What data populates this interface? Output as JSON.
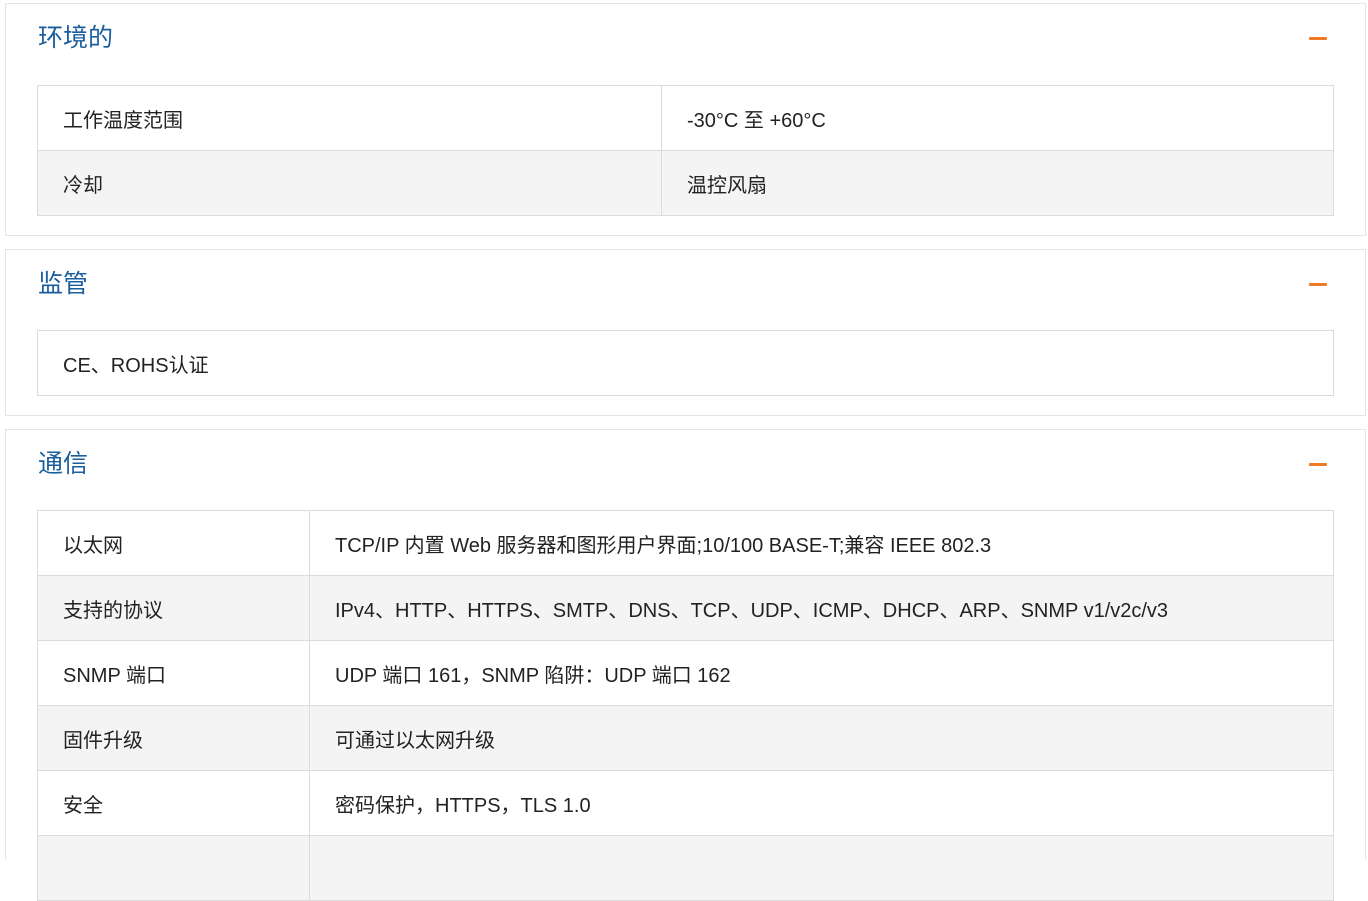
{
  "sections": {
    "environment": {
      "title": "环境的",
      "rows": [
        {
          "label": "工作温度范围",
          "value": "-30°C 至 +60°C"
        },
        {
          "label": "冷却",
          "value": "温控风扇"
        }
      ]
    },
    "regulatory": {
      "title": "监管",
      "text": "CE、ROHS认证"
    },
    "communication": {
      "title": "通信",
      "rows": [
        {
          "label": "以太网",
          "value": "TCP/IP 内置 Web 服务器和图形用户界面;10/100 BASE-T;兼容 IEEE 802.3"
        },
        {
          "label": "支持的协议",
          "value": "IPv4、HTTP、HTTPS、SMTP、DNS、TCP、UDP、ICMP、DHCP、ARP、SNMP v1/v2c/v3"
        },
        {
          "label": "SNMP 端口",
          "value": "UDP 端口 161，SNMP 陷阱：UDP 端口 162"
        },
        {
          "label": "固件升级",
          "value": "可通过以太网升级"
        },
        {
          "label": "安全",
          "value": "密码保护，HTTPS，TLS 1.0"
        },
        {
          "label": "",
          "value": ""
        }
      ]
    }
  },
  "colors": {
    "title": "#1b5e9e",
    "collapse_icon": "#f07a26",
    "row_alt_bg": "#f4f4f4",
    "border": "#dcdcdc"
  },
  "icons": {
    "collapse": "minus-icon"
  }
}
